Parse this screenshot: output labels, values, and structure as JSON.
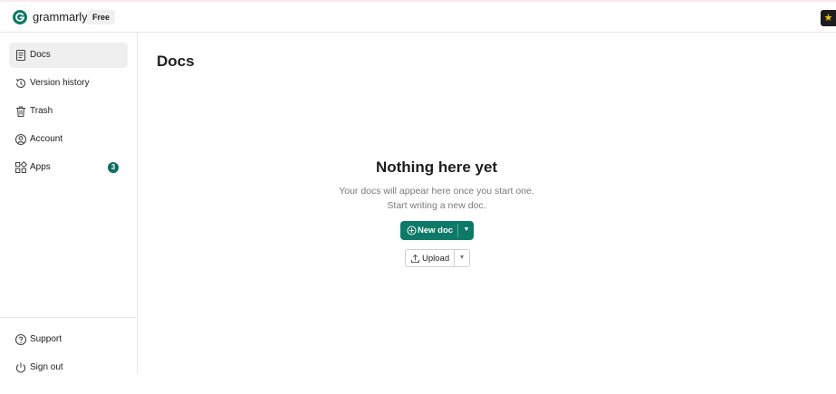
{
  "header": {
    "brand": "grammarly",
    "plan_badge": "Free",
    "logo_icon": "grammarly-g-logo",
    "corner_icon": "star-icon"
  },
  "sidebar": {
    "items": [
      {
        "label": "Docs",
        "icon": "document-icon",
        "active": true
      },
      {
        "label": "Version history",
        "icon": "history-icon"
      },
      {
        "label": "Trash",
        "icon": "trash-icon"
      },
      {
        "label": "Account",
        "icon": "account-icon"
      },
      {
        "label": "Apps",
        "icon": "apps-grid-icon",
        "badge": "3"
      }
    ],
    "footer": [
      {
        "label": "Support",
        "icon": "help-icon"
      },
      {
        "label": "Sign out",
        "icon": "power-icon"
      }
    ]
  },
  "main": {
    "title": "Docs",
    "empty_title": "Nothing here yet",
    "empty_line1": "Your docs will appear here once you start one.",
    "empty_line2": "Start writing a new doc.",
    "new_doc_label": "New doc",
    "upload_label": "Upload"
  },
  "colors": {
    "accent": "#0d7a67",
    "badge": "#0d6e64",
    "active_bg": "#efefef",
    "muted_text": "#7a7a7a"
  }
}
